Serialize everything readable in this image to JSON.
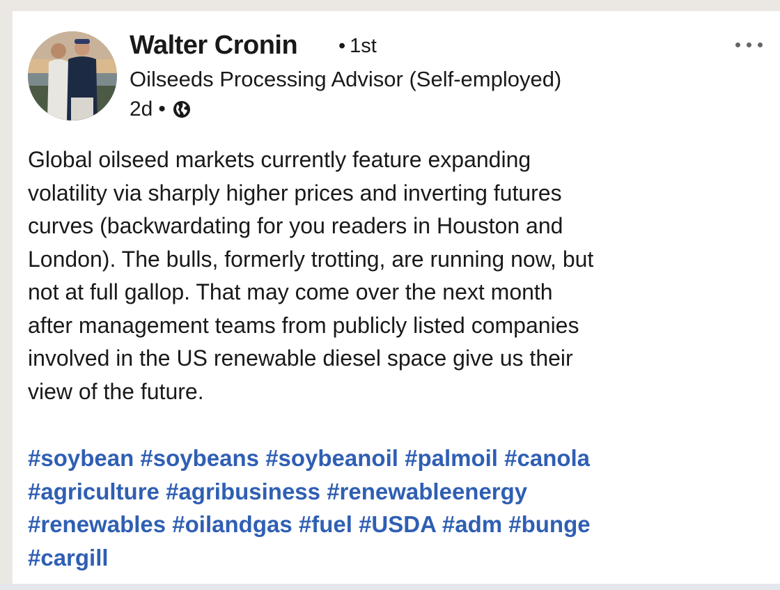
{
  "post": {
    "author": {
      "name": "Walter Cronin",
      "degree": "1st",
      "headline": "Oilseeds Processing Advisor (Self-employed)",
      "time": "2d",
      "visibility_icon": "globe-icon"
    },
    "more_icon": "ellipsis-icon",
    "body_lines": [
      "Global oilseed markets currently feature expanding",
      "volatility via sharply higher prices and inverting futures",
      "curves (backwardating for you readers in Houston and",
      "London). The bulls, formerly trotting, are running now, but",
      "not at full gallop. That may come over the next month",
      "after management teams from publicly listed companies",
      "involved in the US renewable diesel space give us their",
      "view of the future."
    ],
    "hashtag_rows": [
      [
        "#soybean",
        "#soybeans",
        "#soybeanoil",
        "#palmoil",
        "#canola"
      ],
      [
        "#agriculture",
        "#agribusiness",
        "#renewableenergy"
      ],
      [
        "#renewables",
        "#oilandgas",
        "#fuel",
        "#USDA",
        "#adm",
        "#bunge"
      ],
      [
        "#cargill"
      ]
    ]
  },
  "colors": {
    "hashtag": "#2f5fb3",
    "text": "#191919",
    "background": "#ebe8e3",
    "card": "#ffffff"
  }
}
